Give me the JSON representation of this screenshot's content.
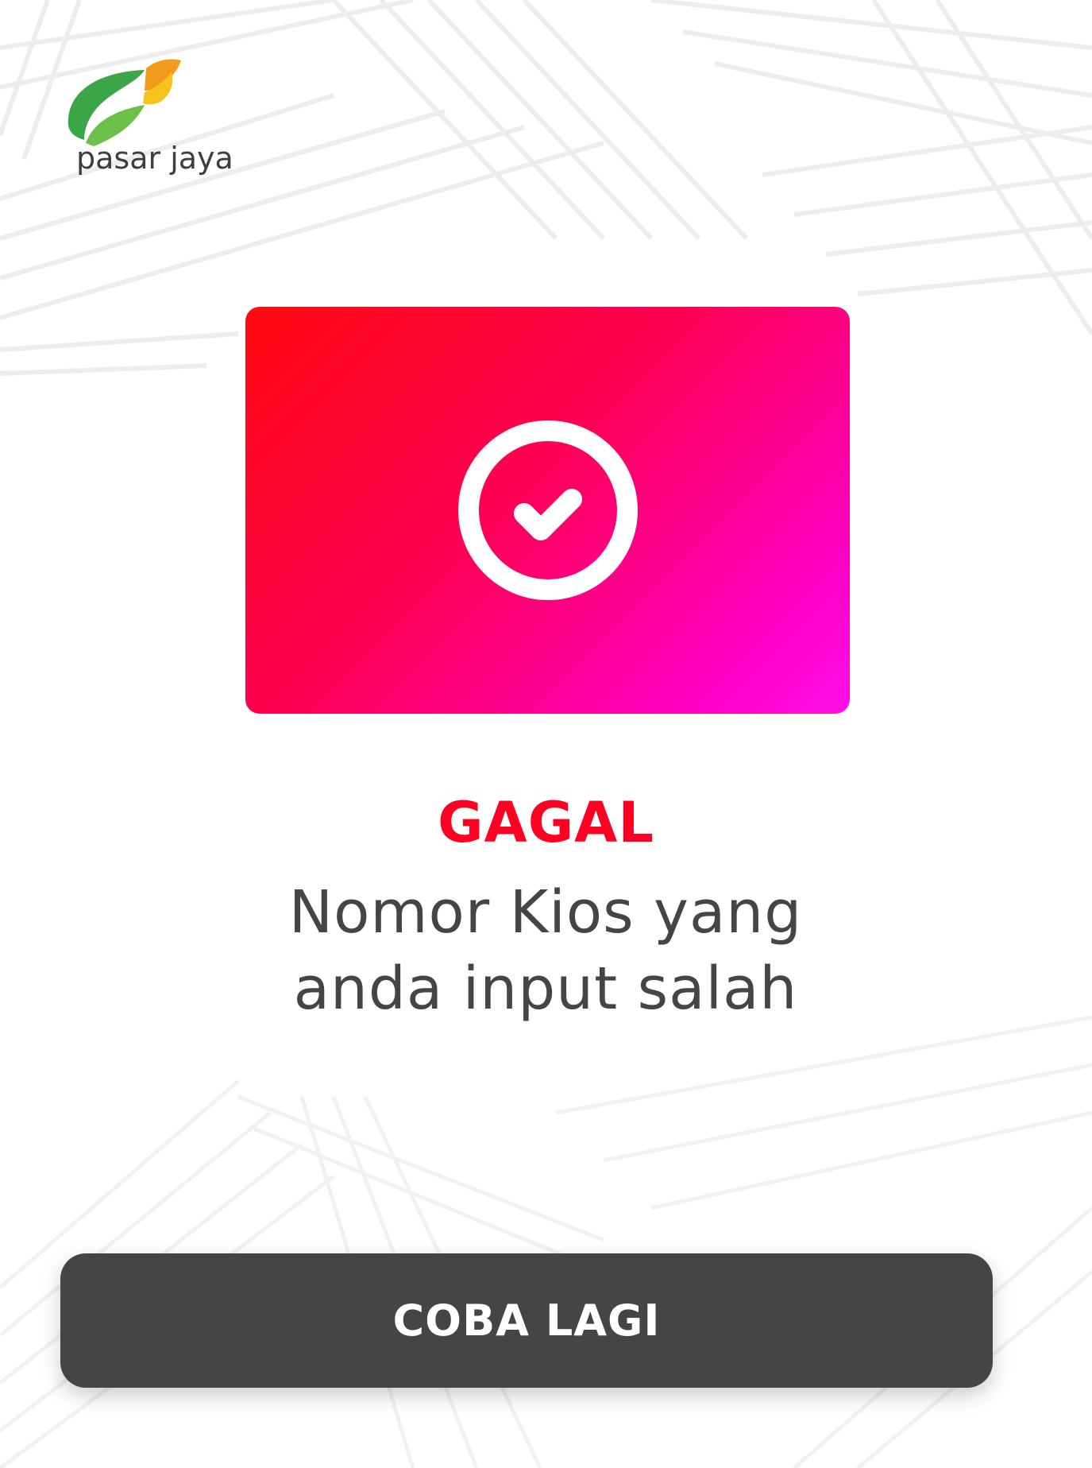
{
  "brand": {
    "name": "pasar jaya",
    "logo_icon": "leaf-logo-icon",
    "colors": {
      "leaf_green": "#3aa648",
      "leaf_orange": "#f6a21b",
      "text": "#3e3e3e"
    }
  },
  "status": {
    "icon": "check-circle-icon",
    "title": "GAGAL",
    "message_line1": "Nomor Kios yang",
    "message_line2": "anda input salah",
    "colors": {
      "title": "#ff0022",
      "card_gradient_start": "#ff0a0f",
      "card_gradient_end": "#ff10e8",
      "message": "#454545"
    }
  },
  "actions": {
    "retry_label": "COBA LAGI",
    "retry_color": "#454545"
  }
}
